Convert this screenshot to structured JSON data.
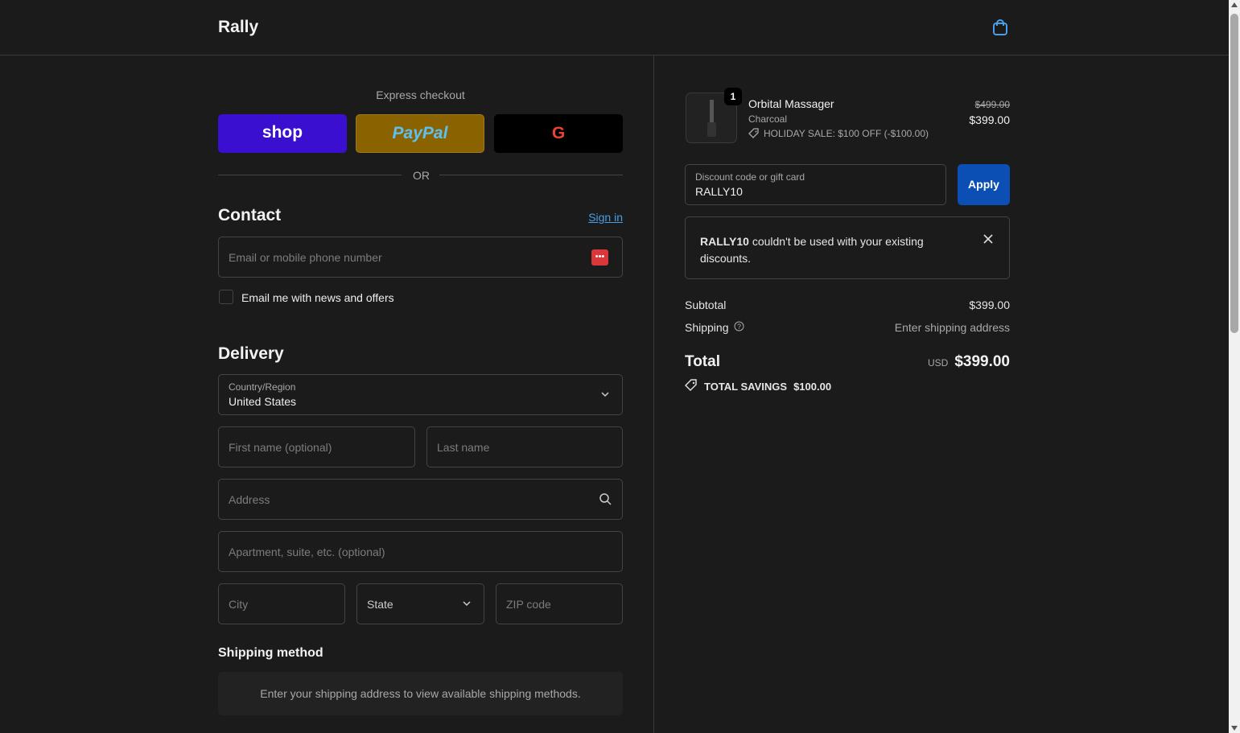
{
  "header": {
    "logo": "Rally",
    "cart_icon": "shopping-bag-icon"
  },
  "express": {
    "title": "Express checkout",
    "shop": "shop",
    "paypal": "PayPal",
    "google": "G",
    "or": "OR"
  },
  "contact": {
    "title": "Contact",
    "sign_in": "Sign in",
    "email_placeholder": "Email or mobile phone number",
    "newsletter": "Email me with news and offers"
  },
  "delivery": {
    "title": "Delivery",
    "country_label": "Country/Region",
    "country_value": "United States",
    "first_name": "First name (optional)",
    "last_name": "Last name",
    "address": "Address",
    "apartment": "Apartment, suite, etc. (optional)",
    "city": "City",
    "state": "State",
    "zip": "ZIP code"
  },
  "shipping_method": {
    "title": "Shipping method",
    "message": "Enter your shipping address to view available shipping methods."
  },
  "summary": {
    "item": {
      "quantity": "1",
      "name": "Orbital Massager",
      "variant": "Charcoal",
      "discount": "HOLIDAY SALE: $100 OFF (-$100.00)",
      "original_price": "$499.00",
      "price": "$399.00"
    },
    "discount_label": "Discount code or gift card",
    "discount_value": "RALLY10",
    "apply": "Apply",
    "error_code": "RALLY10",
    "error_text": " couldn't be used with your existing discounts.",
    "subtotal_label": "Subtotal",
    "subtotal": "$399.00",
    "shipping_label": "Shipping",
    "shipping_value": "Enter shipping address",
    "total_label": "Total",
    "currency": "USD",
    "total": "$399.00",
    "savings_label": "TOTAL SAVINGS",
    "savings": "$100.00"
  },
  "colors": {
    "shop": "#3a0fcf",
    "paypal": "#8a6200",
    "apply": "#0b4fb5",
    "link": "#4a9de8"
  }
}
